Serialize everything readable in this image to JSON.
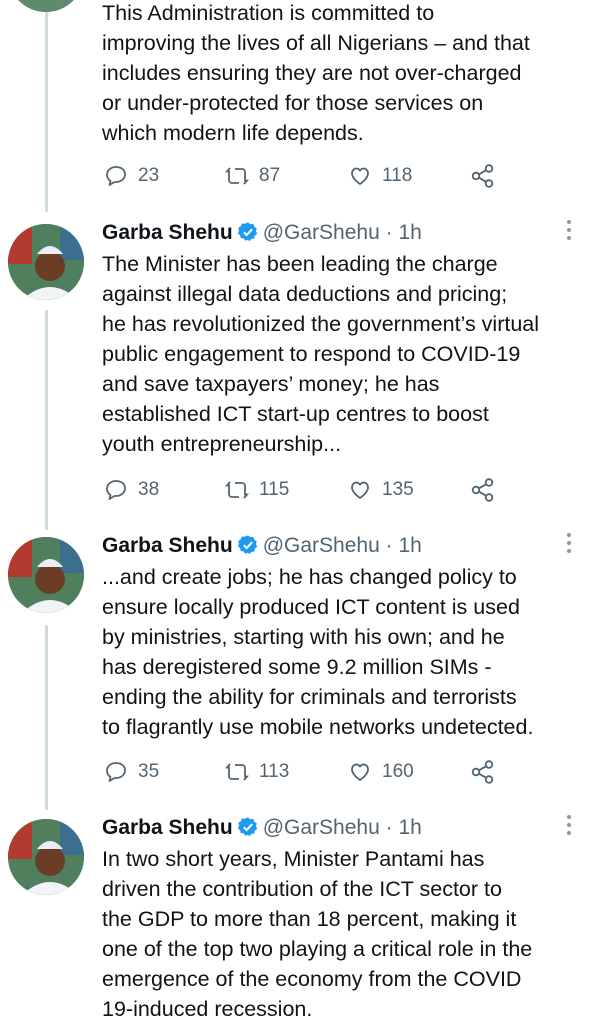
{
  "tweets": [
    {
      "text": "This Administration is committed to\nimproving the lives of all Nigerians – and that\nincludes ensuring they are not over-charged\nor under-protected for those services on\nwhich modern life depends.",
      "replies": "23",
      "retweets": "87",
      "likes": "118"
    },
    {
      "name": "Garba Shehu",
      "handle": "@GarShehu",
      "sep": "·",
      "time": "1h",
      "text": "The Minister has been leading the charge\nagainst illegal data deductions and pricing;\nhe has revolutionized the government’s virtual\npublic engagement to respond to COVID-19\nand save taxpayers’ money; he has\nestablished ICT start-up centres to boost\nyouth entrepreneurship...",
      "replies": "38",
      "retweets": "115",
      "likes": "135"
    },
    {
      "name": "Garba Shehu",
      "handle": "@GarShehu",
      "sep": "·",
      "time": "1h",
      "text": "...and create jobs; he has changed policy to\nensure locally produced ICT content is used\nby ministries, starting with his own; and he\nhas deregistered some 9.2 million SIMs -\nending the ability for criminals and terrorists\nto flagrantly use mobile networks undetected.",
      "replies": "35",
      "retweets": "113",
      "likes": "160"
    },
    {
      "name": "Garba Shehu",
      "handle": "@GarShehu",
      "sep": "·",
      "time": "1h",
      "text": "In two short years, Minister Pantami has\ndriven the contribution of the ICT sector to\nthe GDP to more than 18 percent, making it\none of the top two playing a critical role in the\nemergence of the economy from the COVID\n19-induced recession."
    }
  ],
  "icons": {
    "reply": "reply-icon",
    "retweet": "retweet-icon",
    "like": "heart-icon",
    "share": "share-icon",
    "verified": "verified-badge-icon",
    "more": "more-options-icon"
  },
  "colors": {
    "verified": "#1d9bf0",
    "muted": "#536471",
    "thread": "#cfd9de"
  }
}
